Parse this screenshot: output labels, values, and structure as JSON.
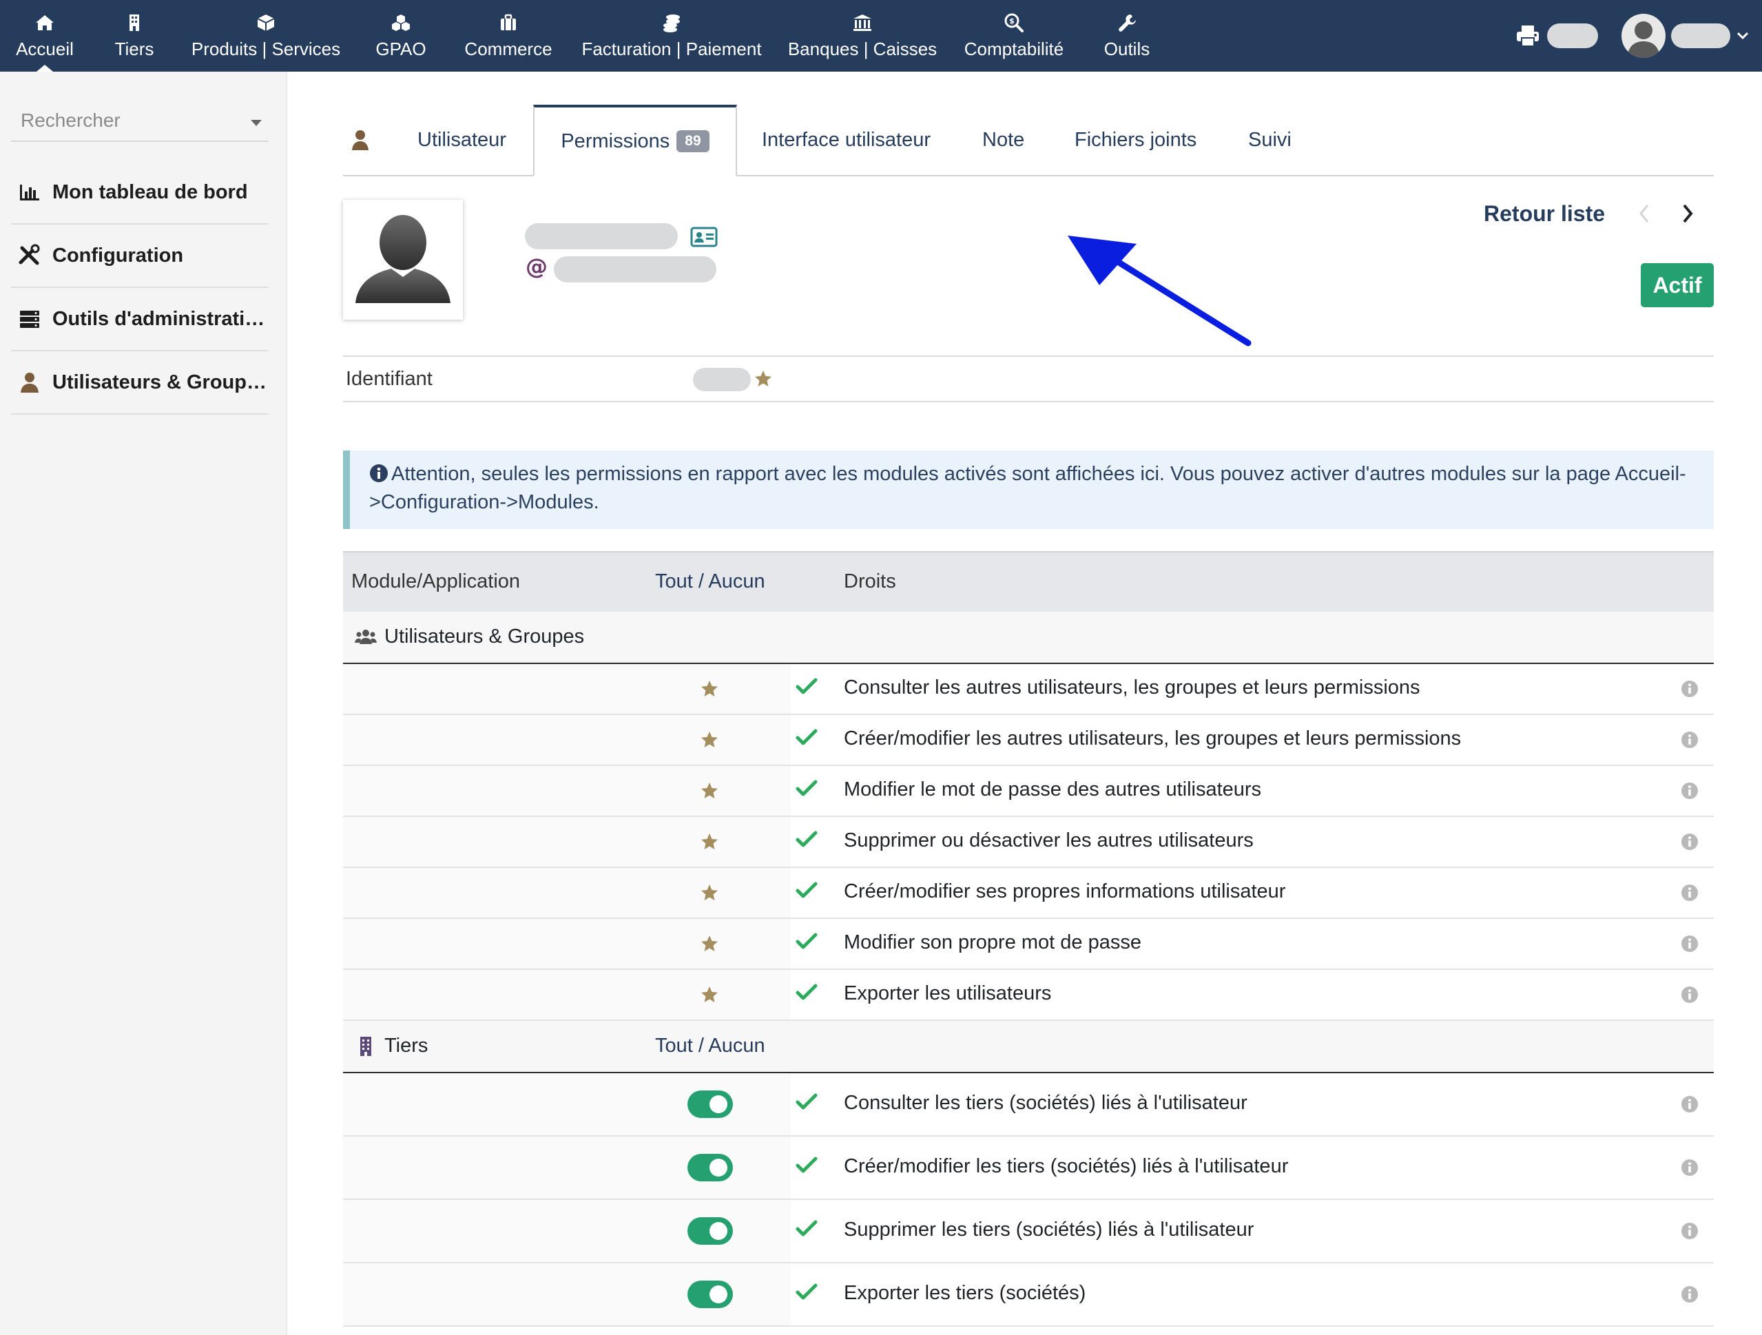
{
  "topnav": {
    "items": [
      {
        "label": "Accueil",
        "icon": "home-icon",
        "active": true
      },
      {
        "label": "Tiers",
        "icon": "building-icon"
      },
      {
        "label": "Produits | Services",
        "icon": "cube-icon"
      },
      {
        "label": "GPAO",
        "icon": "cubes-icon"
      },
      {
        "label": "Commerce",
        "icon": "suitcase-icon"
      },
      {
        "label": "Facturation | Paiement",
        "icon": "coins-icon"
      },
      {
        "label": "Banques | Caisses",
        "icon": "bank-icon"
      },
      {
        "label": "Comptabilité",
        "icon": "search-dollar-icon"
      },
      {
        "label": "Outils",
        "icon": "wrench-icon"
      }
    ]
  },
  "sidebar": {
    "search_placeholder": "Rechercher",
    "items": [
      {
        "label": "Mon tableau de bord",
        "icon": "chart-bar-icon"
      },
      {
        "label": "Configuration",
        "icon": "tools-icon"
      },
      {
        "label": "Outils d'administration",
        "icon": "server-icon"
      },
      {
        "label": "Utilisateurs & Groupes",
        "icon": "user-icon"
      }
    ]
  },
  "tabs": {
    "items": [
      {
        "label": "Utilisateur"
      },
      {
        "label": "Permissions",
        "badge": "89",
        "active": true
      },
      {
        "label": "Interface utilisateur"
      },
      {
        "label": "Note"
      },
      {
        "label": "Fichiers joints"
      },
      {
        "label": "Suivi"
      }
    ]
  },
  "profile": {
    "back_label": "Retour liste",
    "status": "Actif",
    "identifiant_label": "Identifiant"
  },
  "alert": {
    "text": "Attention, seules les permissions en rapport avec les modules activés sont affichées ici. Vous pouvez activer d'autres modules sur la page Accueil->Configuration->Modules."
  },
  "table": {
    "header": {
      "module": "Module/Application",
      "tout": "Tout",
      "separator": " / ",
      "aucun": "Aucun",
      "droits": "Droits"
    },
    "groups": [
      {
        "label": "Utilisateurs & Groupes",
        "icon": "users-icon",
        "show_toggle_all": false,
        "control": "star",
        "rights": [
          "Consulter les autres utilisateurs, les groupes et leurs permissions",
          "Créer/modifier les autres utilisateurs, les groupes et leurs permissions",
          "Modifier le mot de passe des autres utilisateurs",
          "Supprimer ou désactiver les autres utilisateurs",
          "Créer/modifier ses propres informations utilisateur",
          "Modifier son propre mot de passe",
          "Exporter les utilisateurs"
        ]
      },
      {
        "label": "Tiers",
        "icon": "building-icon",
        "show_toggle_all": true,
        "toggle_all": "Tout / Aucun",
        "control": "toggle",
        "rights": [
          "Consulter les tiers (sociétés) liés à l'utilisateur",
          "Créer/modifier les tiers (sociétés) liés à l'utilisateur",
          "Supprimer les tiers (sociétés) liés à l'utilisateur",
          "Exporter les tiers (sociétés)"
        ]
      }
    ]
  },
  "colors": {
    "topbar": "#263c5c",
    "accent_green": "#25a070",
    "check_green": "#2eaa5c",
    "star_gold": "#a58e5d",
    "annotation_arrow": "#0a1ee0"
  }
}
